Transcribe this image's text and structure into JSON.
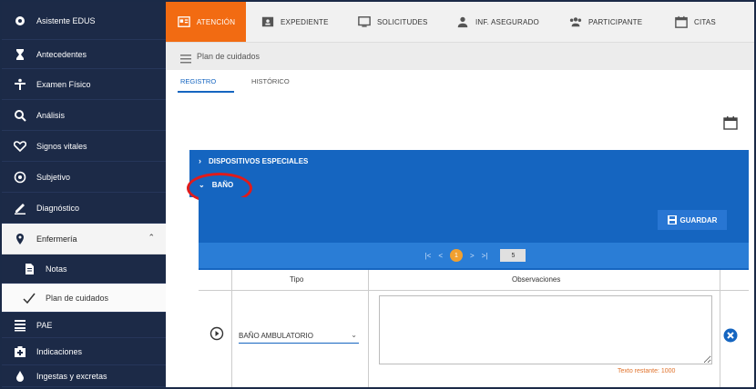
{
  "sidebar": {
    "items": [
      {
        "label": "Asistente EDUS",
        "icon": "gear-icon"
      },
      {
        "label": "Antecedentes",
        "icon": "hourglass-icon"
      },
      {
        "label": "Examen Físico",
        "icon": "person-icon"
      },
      {
        "label": "Análisis",
        "icon": "search-icon"
      },
      {
        "label": "Signos vitales",
        "icon": "heart-icon"
      },
      {
        "label": "Subjetivo",
        "icon": "face-icon"
      },
      {
        "label": "Diagnóstico",
        "icon": "pencil-icon"
      },
      {
        "label": "Enfermería",
        "icon": "location-pin-icon"
      },
      {
        "label": "Notas",
        "icon": "document-icon"
      },
      {
        "label": "Plan de cuidados",
        "icon": "check-icon"
      },
      {
        "label": "PAE",
        "icon": "list-icon"
      },
      {
        "label": "Indicaciones",
        "icon": "first-aid-icon"
      },
      {
        "label": "Ingestas y excretas",
        "icon": "drop-icon"
      }
    ]
  },
  "topbar": {
    "tabs": [
      {
        "label": "ATENCIÓN",
        "icon": "id-card-icon"
      },
      {
        "label": "EXPEDIENTE",
        "icon": "folder-person-icon"
      },
      {
        "label": "SOLICITUDES",
        "icon": "monitor-icon"
      },
      {
        "label": "INF. ASEGURADO",
        "icon": "person-icon"
      },
      {
        "label": "PARTICIPANTE",
        "icon": "group-icon"
      },
      {
        "label": "CITAS",
        "icon": "calendar-icon"
      }
    ]
  },
  "subheader": {
    "title": "Plan de cuidados"
  },
  "subtabs": [
    "REGISTRO",
    "HISTÓRICO"
  ],
  "sections": {
    "dispositivos": "DISPOSITIVOS ESPECIALES",
    "bano": "BAÑO"
  },
  "panel": {
    "save_label": "GUARDAR",
    "pager": {
      "first": "|<",
      "prev": "<",
      "current": "1",
      "next": ">",
      "last": ">|",
      "page_size": "5"
    }
  },
  "table": {
    "headers": [
      "Tipo",
      "Observaciones"
    ],
    "row": {
      "tipo": "BAÑO AMBULATORIO",
      "observaciones": "",
      "counter": "Texto restante: 1000"
    }
  },
  "colors": {
    "navy": "#1c2a47",
    "orange": "#f26b12",
    "blue": "#1565c0",
    "highlight": "#e01b1b"
  }
}
